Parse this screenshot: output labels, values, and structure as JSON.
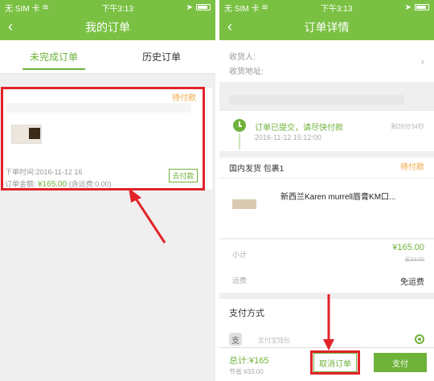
{
  "left": {
    "status": {
      "carrier": "无 SIM 卡",
      "time": "下午3:13"
    },
    "title": "我的订单",
    "tabs": [
      {
        "label": "未完成订单",
        "active": true
      },
      {
        "label": "历史订单",
        "active": false
      }
    ],
    "order": {
      "status": "待付款",
      "time": "下单时间:2016-11-12 16",
      "amount_label": "订单金额:",
      "amount": "¥165.00",
      "shipping_note": "(含运费:0.00)",
      "pay_button": "去付款"
    }
  },
  "right": {
    "status": {
      "carrier": "无 SIM 卡",
      "time": "下午3:13"
    },
    "title": "订单详情",
    "address": {
      "recipient_label": "收货人:",
      "address_label": "收货地址:"
    },
    "progress": {
      "text": "订单已提交，请尽快付款",
      "date": "2016-11-12 15:12:00",
      "countdown": "剩28分34秒"
    },
    "package": {
      "title": "国内发货 包裹1",
      "status": "待付款"
    },
    "product": {
      "name": "新西兰Karen murrell唇膏KM口..."
    },
    "subtotal": {
      "label": "小计",
      "value": "¥165.00",
      "original": "省33.00"
    },
    "shipping": {
      "label": "运费",
      "value": "免运费"
    },
    "payment": {
      "title": "支付方式",
      "method_label": "支付宝钱包",
      "icon_text": "支"
    },
    "bottom": {
      "total": "总计:¥165",
      "saved": "节省:¥33.00",
      "cancel_button": "取消订单",
      "pay_button": "支付"
    }
  },
  "colors": {
    "brand_green": "#7ac143",
    "highlight_red": "#e2232a",
    "pending_orange": "#f0a540"
  }
}
